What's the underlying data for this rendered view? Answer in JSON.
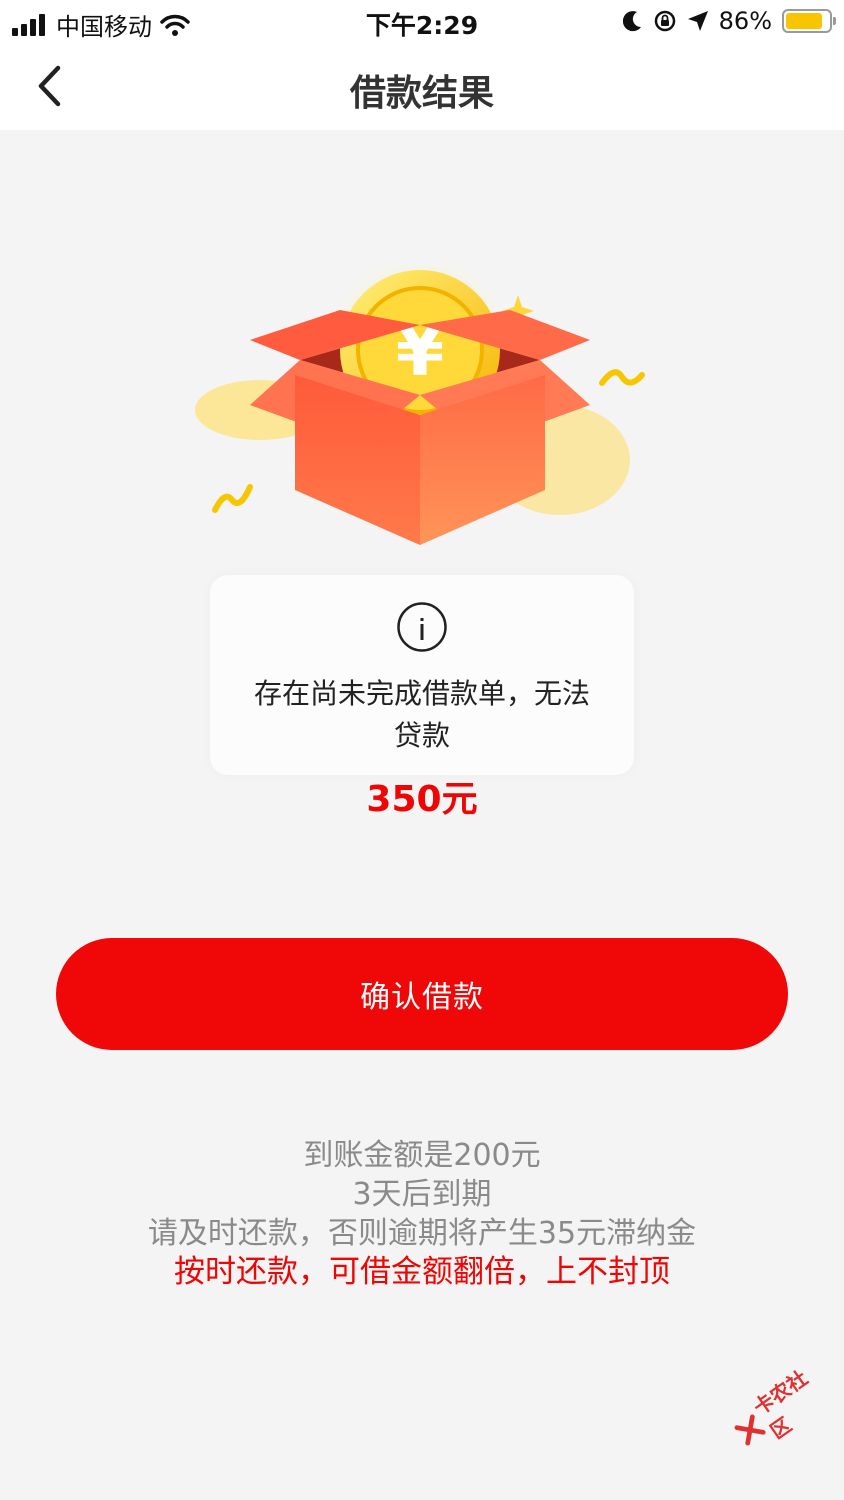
{
  "status_bar": {
    "carrier": "中国移动",
    "time": "下午2:29",
    "battery_percent": "86%",
    "battery_level": 0.86,
    "battery_color": "#f7c600"
  },
  "nav": {
    "title": "借款结果",
    "back_icon": "chevron-left-icon"
  },
  "illustration": {
    "icon": "gift-box-coin-icon",
    "coin_symbol": "¥"
  },
  "toast": {
    "icon": "info-icon",
    "message_line1": "存在尚未完成借款单，无法",
    "message_line2": "贷款"
  },
  "loan": {
    "amount": "350元",
    "amount_color": "#f00505"
  },
  "confirm_button": {
    "label": "确认借款",
    "color": "#f00707"
  },
  "info": {
    "line1": "到账金额是200元",
    "line2": "3天后到期",
    "line3": "请及时还款，否则逾期将产生35元滞纳金",
    "line4": "按时还款，可借金额翻倍，上不封顶"
  },
  "watermark": {
    "text": "卡农社区"
  }
}
